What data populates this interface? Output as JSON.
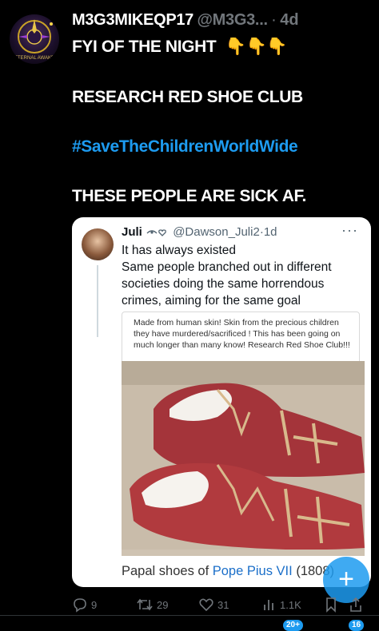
{
  "post": {
    "display_name": "M3G3MIKEQP17",
    "handle": "@M3G3...",
    "dot": "·",
    "time": "4d",
    "lines": [
      "FYI OF THE NIGHT",
      "RESEARCH RED SHOE CLUB",
      "#SaveTheChildrenWorldWide",
      "THESE PEOPLE ARE SICK AF."
    ],
    "emoji": "👇👇👇",
    "avatar_text": "ETERNAL AWAKE"
  },
  "quote": {
    "name": "Juli",
    "handle": "@Dawson_Juli2",
    "dot": "·",
    "time": "1d",
    "more": "···",
    "text_lines": [
      "It has always existed",
      "Same people branched out in different",
      "societies doing the same horrendous",
      "crimes, aiming for the same goal"
    ],
    "inner_caption": "Made from human skin! Skin from the precious children they have murdered/sacrificed ! This has been going on much longer than many know! Research Red Shoe Club!!!",
    "bottom_caption_prefix": "Papal shoes of ",
    "bottom_caption_link": "Pope Pius VII",
    "bottom_caption_suffix": " (1808)"
  },
  "actions": {
    "replies": "9",
    "reposts": "29",
    "likes": "31",
    "views": "1.1K"
  },
  "fab": {
    "label": "+"
  },
  "nav": {
    "badge_left": "20+",
    "badge_right": "16"
  },
  "colors": {
    "accent": "#1d9bf0",
    "background": "#000000",
    "muted": "#71767b"
  }
}
